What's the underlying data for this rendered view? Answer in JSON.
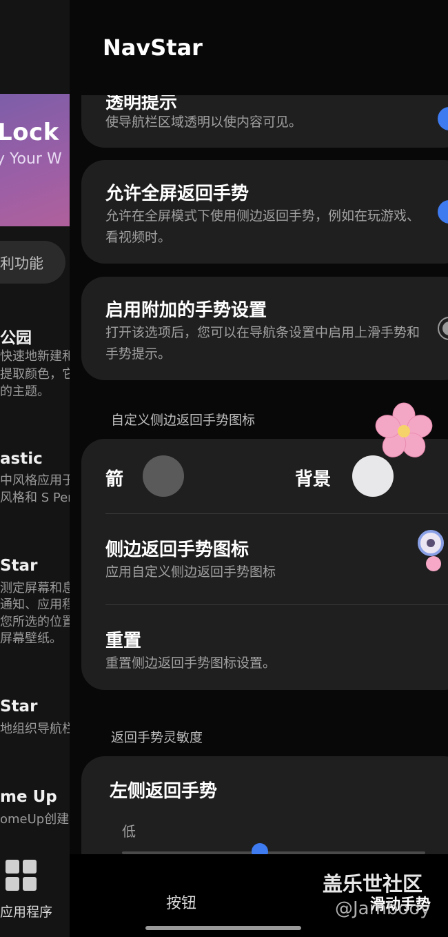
{
  "left_panel": {
    "banner": {
      "title": "Lock",
      "subtitle": "y Your W"
    },
    "chip_label": "利功能",
    "apps": [
      {
        "title": "公园",
        "desc": [
          "快速地新建和",
          "提取颜色，它",
          "的主题。"
        ]
      },
      {
        "title": "astic",
        "desc": [
          "中风格应用于",
          "风格和 S Pen"
        ]
      },
      {
        "title": "Star",
        "desc": [
          "测定屏幕和息",
          "通知、应用程",
          "您所选的位置",
          "屏幕壁纸。"
        ]
      },
      {
        "title": "Star",
        "desc": [
          "地组织导航栏"
        ]
      },
      {
        "title": "me Up",
        "desc": [
          "omeUp创建"
        ]
      }
    ],
    "apps_label": "应用程序"
  },
  "header": {
    "title": "NavStar"
  },
  "settings": {
    "transparent_hint": {
      "title": "透明提示",
      "desc": "使导航栏区域透明以使内容可见。",
      "enabled": true
    },
    "fullscreen_back": {
      "title": "允许全屏返回手势",
      "desc": "允许在全屏模式下使用侧边返回手势，例如在玩游戏、看视频时。",
      "enabled": true
    },
    "extra_gestures": {
      "title": "启用附加的手势设置",
      "desc": "打开该选项后，您可以在导航条设置中启用上滑手势和手势提示。",
      "enabled": false
    },
    "custom_icon_section": "自定义侧边返回手势图标",
    "arrow_label": "箭",
    "background_label": "背景",
    "arrow_color": "#5a5a5a",
    "background_color": "#e8e8ea",
    "side_icon": {
      "title": "侧边返回手势图标",
      "desc": "应用自定义侧边返回手势图标"
    },
    "reset": {
      "title": "重置",
      "desc": "重置侧边返回手势图标设置。"
    },
    "sensitivity_section": "返回手势灵敏度",
    "left_gesture": {
      "title": "左侧返回手势",
      "low_label": "低"
    }
  },
  "bottom": {
    "button_tab": "按钮",
    "gesture_tab": "滑动手势",
    "watermark_site": "盖乐世社区",
    "watermark_user": "@Jambooy"
  },
  "colors": {
    "accent": "#3e7bf0",
    "card": "#1f1f1f",
    "background": "#080808"
  }
}
